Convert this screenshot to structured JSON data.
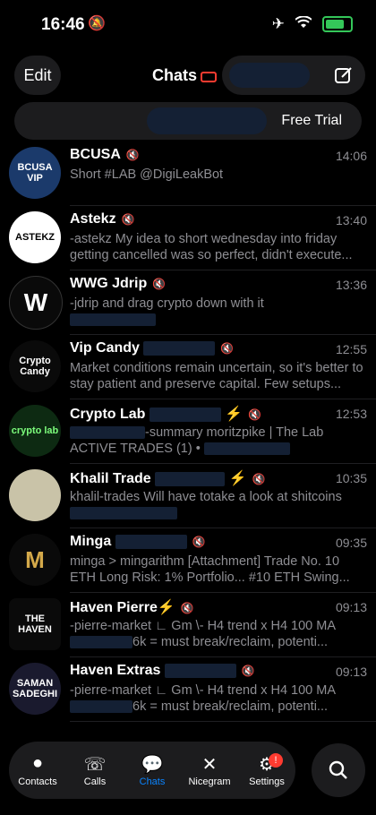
{
  "status": {
    "time": "16:46"
  },
  "header": {
    "edit": "Edit",
    "title": "Chats"
  },
  "search": {
    "free_trial": "Free Trial"
  },
  "chats": [
    {
      "name": "BCUSA",
      "time": "14:06",
      "preview": "Short #LAB  @DigiLeakBot",
      "avatar_text": "BCUSA VIP",
      "avatar_bg": "#1b3a6b"
    },
    {
      "name": "Astekz",
      "time": "13:40",
      "preview": "-astekz My idea to short wednesday into friday getting cancelled was so perfect, didn't execute...",
      "avatar_text": "ASTEKZ",
      "avatar_bg": "#ffffff"
    },
    {
      "name": "WWG Jdrip",
      "time": "13:36",
      "preview": "-jdrip and drag crypto down with it",
      "avatar_text": "W",
      "avatar_bg": "#0a0a0a"
    },
    {
      "name": "Vip Candy",
      "time": "12:55",
      "preview": "Market conditions remain uncertain, so it's better to stay patient and preserve capital. Few setups...",
      "avatar_text": "Crypto Candy",
      "avatar_bg": "#0a0a0a"
    },
    {
      "name": "Crypto Lab",
      "time": "12:53",
      "preview": "-summary moritzpike | The Lab",
      "preview2": "ACTIVE TRADES (1) •",
      "avatar_text": "crypto lab",
      "avatar_bg": "#0d2a12"
    },
    {
      "name": "Khalil Trade",
      "time": "10:35",
      "preview": "khalil-trades Will have totake a look at shitcoins",
      "avatar_text": "",
      "avatar_bg": "#c9c3a8"
    },
    {
      "name": "Minga",
      "time": "09:35",
      "preview": "minga > mingarithm [Attachment] Trade No. 10 ETH Long Risk: 1% Portfolio... #10 ETH Swing...",
      "avatar_text": "M",
      "avatar_bg": "#0a0a0a"
    },
    {
      "name": "Haven Pierre⚡",
      "time": "09:13",
      "preview": "-pierre-market ∟ Gm \\- H4 trend x H4 100 MA",
      "preview_tail": "6k = must break/reclaim, potenti...",
      "avatar_text": "THE HAVEN",
      "avatar_bg": "#0a0a0a"
    },
    {
      "name": "Haven Extras",
      "time": "09:13",
      "preview": "-pierre-market ∟ Gm \\- H4 trend x H4 100 MA",
      "preview_tail": "6k = must break/reclaim, potenti...",
      "avatar_text": "SAMAN SADEGHI",
      "avatar_bg": "#1a1a2e"
    }
  ],
  "tabs": [
    {
      "label": "Contacts",
      "icon": "person-icon"
    },
    {
      "label": "Calls",
      "icon": "phone-icon"
    },
    {
      "label": "Chats",
      "icon": "chat-bubble-icon"
    },
    {
      "label": "Nicegram",
      "icon": "nicegram-icon"
    },
    {
      "label": "Settings",
      "icon": "gear-icon",
      "badge": "!"
    }
  ]
}
